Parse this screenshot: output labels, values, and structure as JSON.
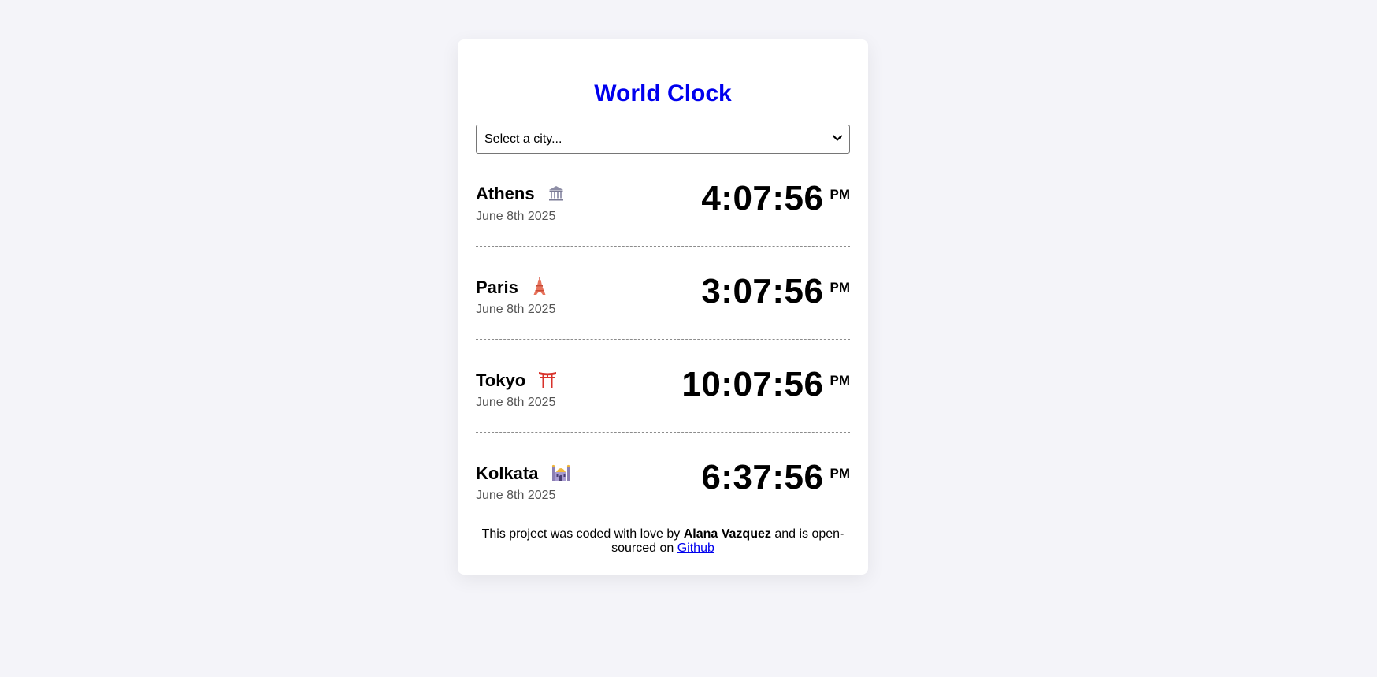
{
  "app": {
    "title": "World Clock"
  },
  "selector": {
    "value": "Select a city..."
  },
  "cities": [
    {
      "name": "Athens",
      "icon": "classical-building-icon",
      "date": "June 8th 2025",
      "time": "4:07:56",
      "ampm": "PM"
    },
    {
      "name": "Paris",
      "icon": "eiffel-tower-icon",
      "date": "June 8th 2025",
      "time": "3:07:56",
      "ampm": "PM"
    },
    {
      "name": "Tokyo",
      "icon": "torii-gate-icon",
      "date": "June 8th 2025",
      "time": "10:07:56",
      "ampm": "PM"
    },
    {
      "name": "Kolkata",
      "icon": "mosque-icon",
      "date": "June 8th 2025",
      "time": "6:37:56",
      "ampm": "PM"
    }
  ],
  "footer": {
    "text_before": "This project was coded with love by ",
    "author": "Alana Vazquez",
    "text_after": " and is open-sourced on ",
    "link_label": "Github"
  },
  "colors": {
    "title": "#0000ee",
    "link": "#0000ee",
    "background": "#f4f4f9"
  }
}
